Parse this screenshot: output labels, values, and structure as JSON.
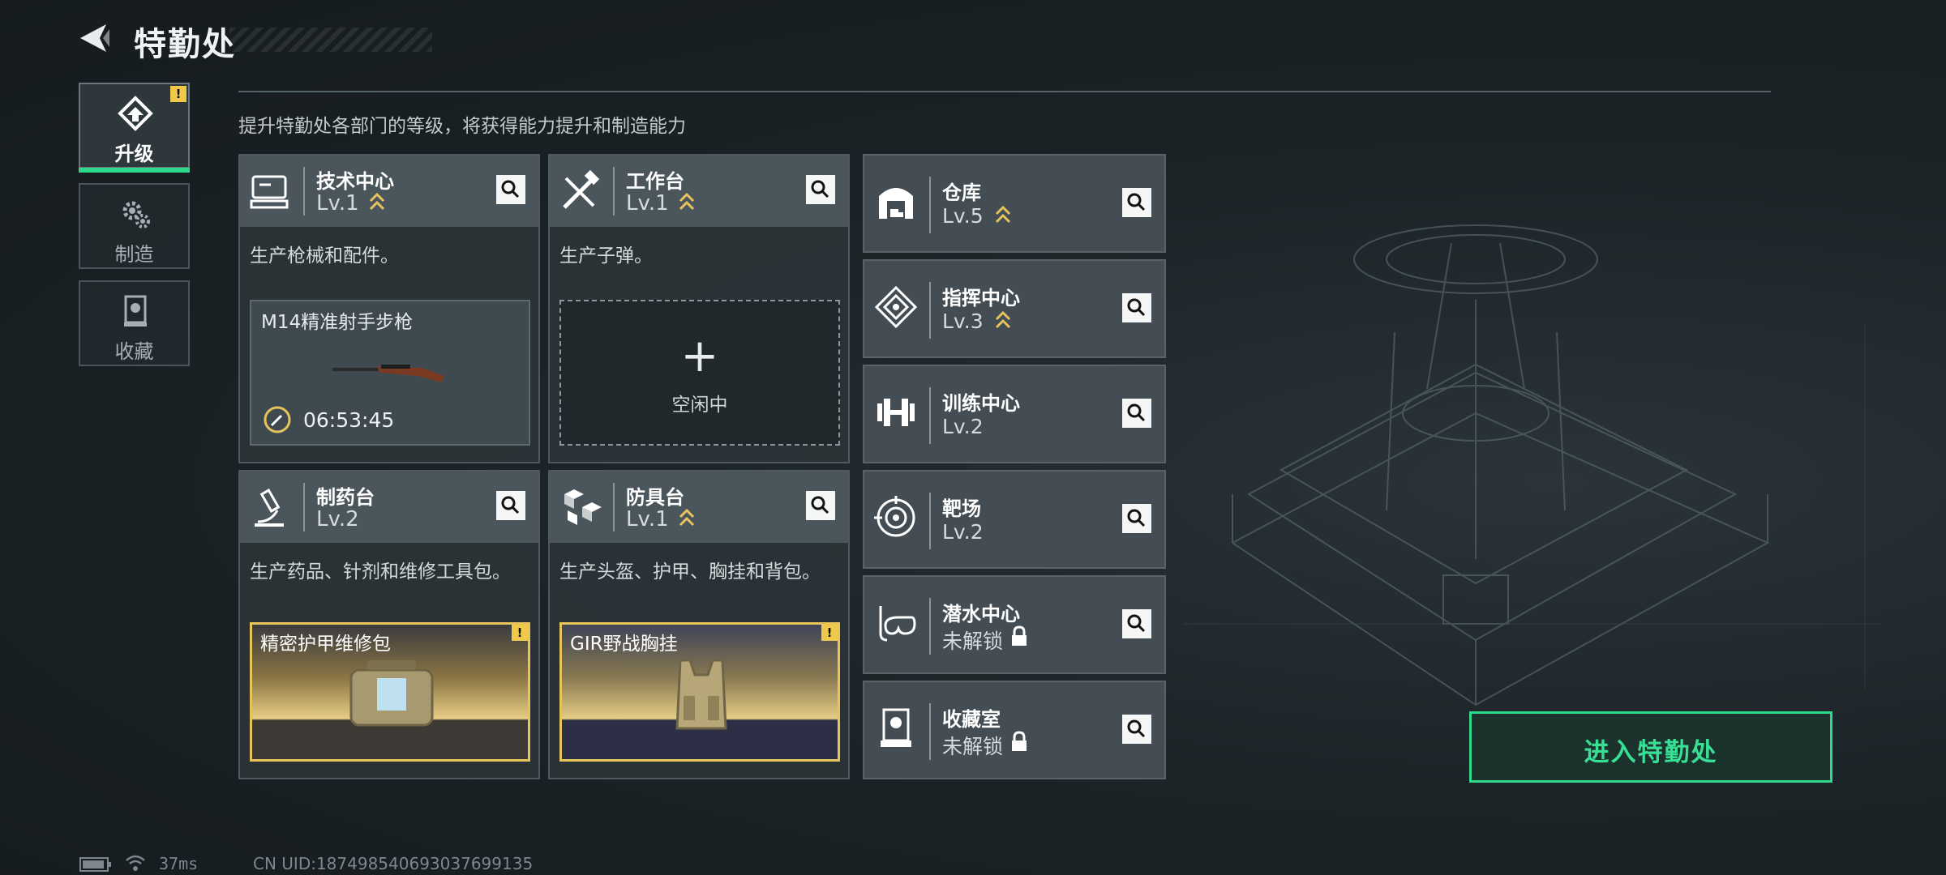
{
  "header": {
    "title": "特勤处"
  },
  "nav": [
    {
      "label": "升级",
      "icon": "upgrade-icon",
      "active": true,
      "warning": "!"
    },
    {
      "label": "制造",
      "icon": "gears-icon",
      "active": false
    },
    {
      "label": "收藏",
      "icon": "collection-icon",
      "active": false
    }
  ],
  "subtitle": "提升特勤处各部门的等级，将获得能力提升和制造能力",
  "cards": [
    {
      "name": "技术中心",
      "level": "Lv.1",
      "upgradable": true,
      "icon": "computer-icon",
      "desc": "生产枪械和配件。",
      "slot": {
        "type": "item",
        "item_name": "M14精准射手步枪",
        "timer": "06:53:45"
      }
    },
    {
      "name": "工作台",
      "level": "Lv.1",
      "upgradable": true,
      "icon": "tools-icon",
      "desc": "生产子弹。",
      "slot": {
        "type": "empty",
        "plus": "+",
        "status": "空闲中"
      }
    },
    {
      "name": "制药台",
      "level": "Lv.2",
      "upgradable": false,
      "icon": "microscope-icon",
      "desc": "生产药品、针剂和维修工具包。",
      "slot": {
        "type": "gold",
        "item_name": "精密护甲维修包",
        "warning": "!"
      }
    },
    {
      "name": "防具台",
      "level": "Lv.1",
      "upgradable": true,
      "icon": "cubes-icon",
      "desc": "生产头盔、护甲、胸挂和背包。",
      "slot": {
        "type": "gold",
        "item_name": "GIR野战胸挂",
        "warning": "!"
      }
    }
  ],
  "facilities": [
    {
      "name": "仓库",
      "level": "Lv.5",
      "upgradable": true,
      "locked": false,
      "icon": "warehouse-icon"
    },
    {
      "name": "指挥中心",
      "level": "Lv.3",
      "upgradable": true,
      "locked": false,
      "icon": "command-icon"
    },
    {
      "name": "训练中心",
      "level": "Lv.2",
      "upgradable": false,
      "locked": false,
      "icon": "dumbbell-icon"
    },
    {
      "name": "靶场",
      "level": "Lv.2",
      "upgradable": false,
      "locked": false,
      "icon": "target-icon"
    },
    {
      "name": "潜水中心",
      "level": "未解锁",
      "upgradable": false,
      "locked": true,
      "icon": "diving-mask-icon"
    },
    {
      "name": "收藏室",
      "level": "未解锁",
      "upgradable": false,
      "locked": true,
      "icon": "trophy-case-icon"
    }
  ],
  "enter_button": "进入特勤处",
  "status": {
    "ping": "37ms",
    "uid": "CN UID:1874985406930376​99135"
  },
  "colors": {
    "accent": "#2fd98c",
    "warning": "#f1c94a",
    "upgrade_chevron": "#e6c35c"
  }
}
